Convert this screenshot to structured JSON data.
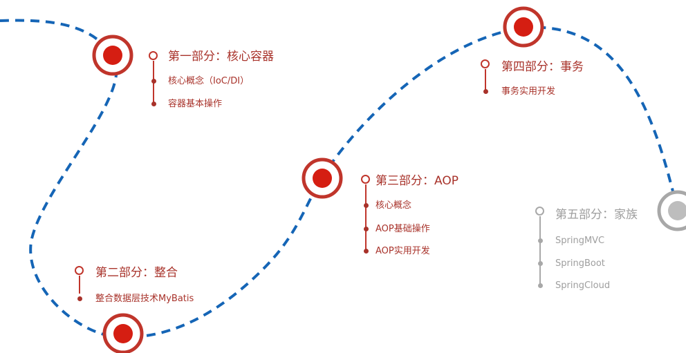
{
  "colors": {
    "route": "#1565b6",
    "active": "#c0352b",
    "active_fill": "#d51e12",
    "inactive": "#a8a8a8",
    "active_text": "#a8322a",
    "inactive_text": "#9e9e9e"
  },
  "sections": [
    {
      "title": "第一部分：核心容器",
      "items": [
        "核心概念（IoC/DI）",
        "容器基本操作"
      ]
    },
    {
      "title": "第二部分：整合",
      "items": [
        "整合数据层技术MyBatis"
      ]
    },
    {
      "title": "第三部分：AOP",
      "items": [
        "核心概念",
        "AOP基础操作",
        "AOP实用开发"
      ]
    },
    {
      "title": "第四部分：事务",
      "items": [
        "事务实用开发"
      ]
    },
    {
      "title": "第五部分：家族",
      "items": [
        "SpringMVC",
        "SpringBoot",
        "SpringCloud"
      ]
    }
  ]
}
